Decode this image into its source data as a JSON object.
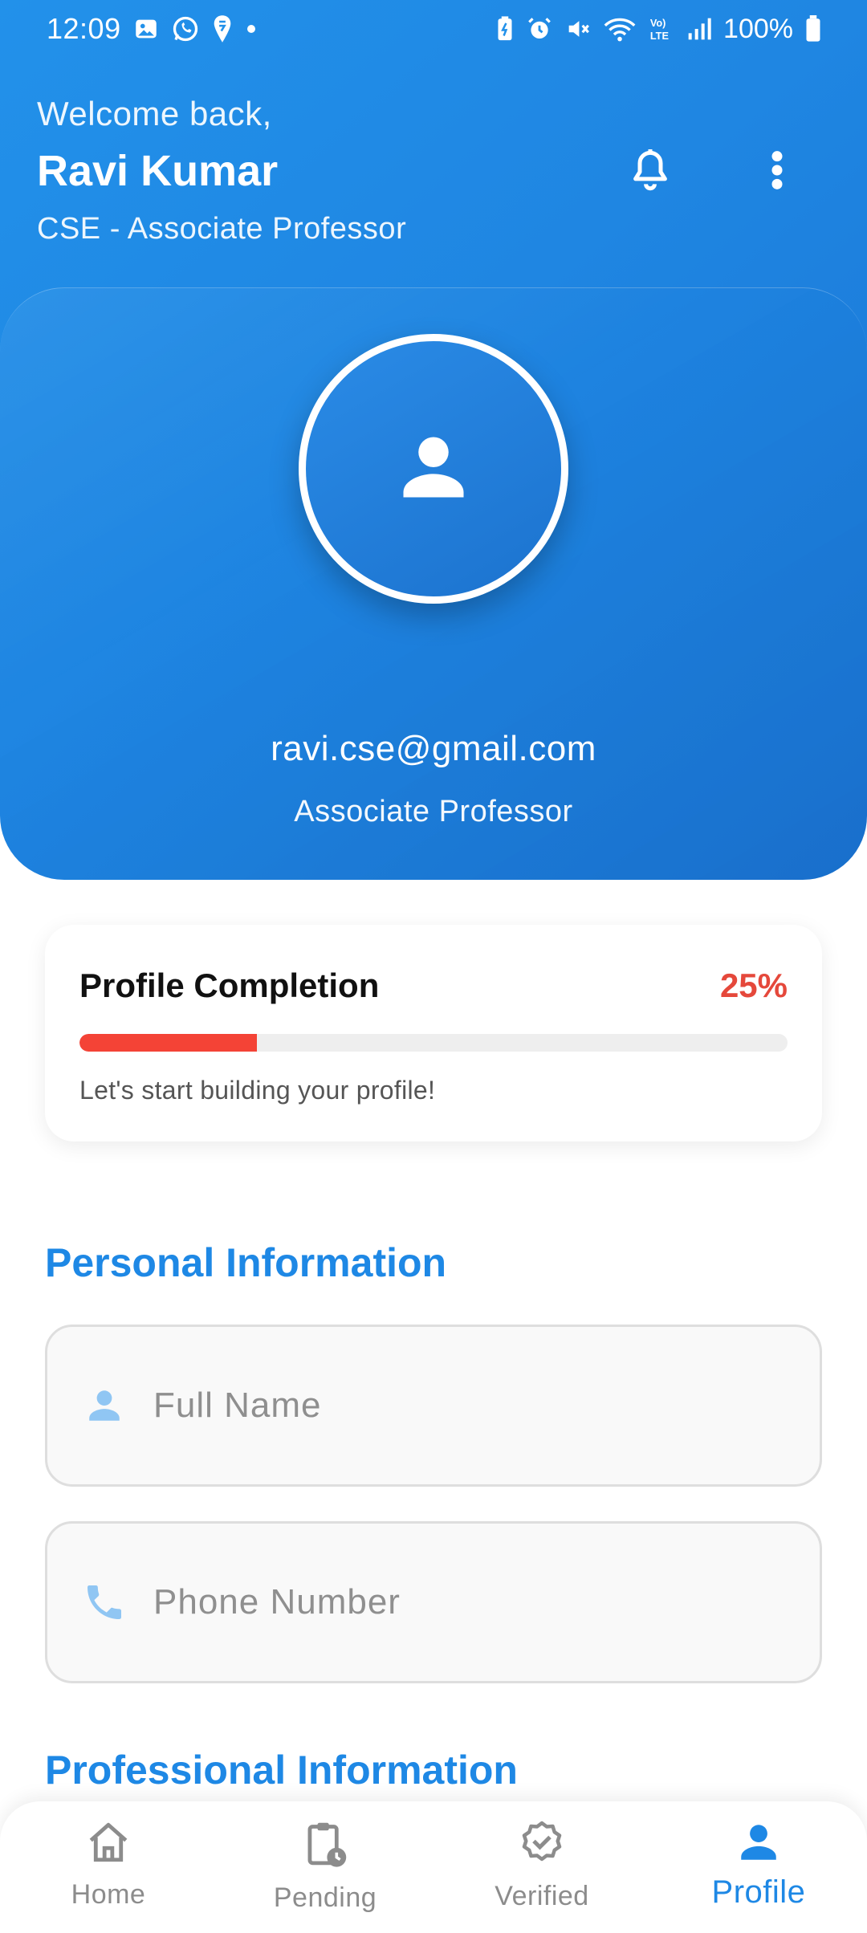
{
  "status_bar": {
    "time": "12:09",
    "battery_percent": "100%",
    "left_icons": [
      "gallery-icon",
      "whatsapp-icon",
      "swiggy-icon",
      "dot-icon"
    ],
    "right_icons": [
      "battery-saver-icon",
      "alarm-icon",
      "mute-icon",
      "wifi-icon",
      "volte-icon",
      "signal-icon",
      "battery-icon"
    ]
  },
  "header": {
    "welcome": "Welcome back,",
    "name": "Ravi Kumar",
    "department": "CSE - Associate Professor",
    "actions": [
      "bell-icon",
      "more-vertical-icon"
    ]
  },
  "profile": {
    "email": "ravi.cse@gmail.com",
    "role": "Associate Professor"
  },
  "completion": {
    "title": "Profile Completion",
    "percent_label": "25%",
    "progress_fraction": 0.25,
    "hint": "Let's start building your profile!",
    "accent_color": "#f44336"
  },
  "personal": {
    "title": "Personal Information",
    "full_name_placeholder": "Full Name",
    "phone_placeholder": "Phone Number"
  },
  "professional": {
    "title": "Professional Information"
  },
  "bottom_nav": {
    "items": [
      {
        "label": "Home",
        "icon": "home-icon",
        "active": false
      },
      {
        "label": "Pending",
        "icon": "pending-clipboard-icon",
        "active": false
      },
      {
        "label": "Verified",
        "icon": "verified-badge-icon",
        "active": false
      },
      {
        "label": "Profile",
        "icon": "person-icon",
        "active": true
      }
    ]
  },
  "colors": {
    "primary": "#1e88e5",
    "header_gradient_start": "#2291ea",
    "header_gradient_end": "#1a74d4",
    "danger": "#e5483b"
  }
}
